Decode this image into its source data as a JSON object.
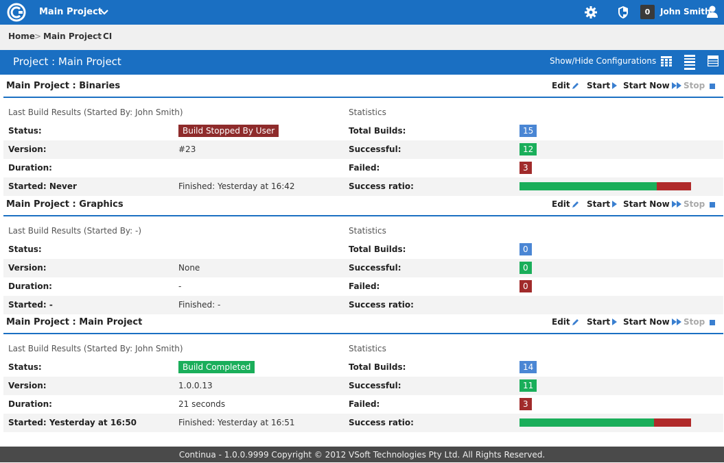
{
  "topbar": {
    "project_name": "Main Project",
    "notification_count": "0",
    "username": "John Smith"
  },
  "breadcrumb": [
    "Home",
    "Main Project",
    "CI"
  ],
  "page_header": {
    "title": "Project : Main Project",
    "show_hide_label": "Show/Hide Configurations"
  },
  "actions": {
    "edit": "Edit",
    "start": "Start",
    "start_now": "Start Now",
    "stop": "Stop"
  },
  "labels": {
    "status": "Status:",
    "version": "Version:",
    "duration": "Duration:",
    "statistics": "Statistics",
    "total_builds": "Total Builds:",
    "successful": "Successful:",
    "failed": "Failed:",
    "success_ratio": "Success ratio:"
  },
  "configurations": [
    {
      "project": "Main Project",
      "name": ": Binaries",
      "last_build_header": "Last Build Results (Started By: John Smith)",
      "status": "Build Stopped By User",
      "version": "#23",
      "duration": "",
      "started": "Started: Never",
      "finished": "Finished: Yesterday at 16:42",
      "total_builds": "15",
      "successful": "12",
      "failed": "3",
      "success_ratio": 0.8
    },
    {
      "project": "Main Project",
      "name": ": Graphics",
      "last_build_header": "Last Build Results (Started By: -)",
      "status": "",
      "version": "None",
      "duration": "-",
      "started": "Started: -",
      "finished": "Finished: -",
      "total_builds": "0",
      "successful": "0",
      "failed": "0",
      "success_ratio": null
    },
    {
      "project": "Main Project",
      "name": ": Main Project",
      "last_build_header": "Last Build Results (Started By: John Smith)",
      "status": "Build Completed",
      "version": "1.0.0.13",
      "duration": "21 seconds",
      "started": "Started: Yesterday at 16:50",
      "finished": "Finished: Yesterday at 16:51",
      "total_builds": "14",
      "successful": "11",
      "failed": "3",
      "success_ratio": 0.7857
    }
  ],
  "footer": "Continua - 1.0.0.9999 Copyright © 2012 VSoft Technologies Pty Ltd. All Rights Reserved.",
  "colors": {
    "brand_blue": "#1a6fc2",
    "success_green": "#1aae5a",
    "failure_red": "#a12b2b",
    "total_blue": "#4a86d4"
  }
}
